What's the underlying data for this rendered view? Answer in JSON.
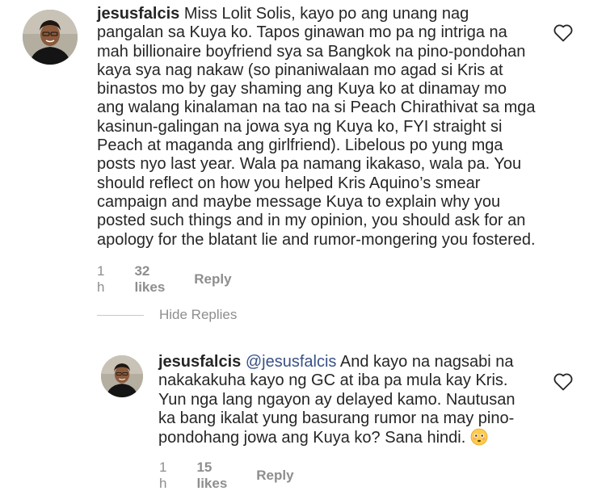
{
  "comments": [
    {
      "username": "jesusfalcis",
      "text": "Miss Lolit Solis, kayo po ang unang nag pangalan sa Kuya ko. Tapos ginawan mo pa ng intriga na mah billionaire boyfriend sya sa Bangkok na pino-pondohan kaya sya nag nakaw (so pinaniwalaan mo agad si Kris at binastos mo by gay shaming ang Kuya ko at dinamay mo ang walang kinalaman na tao na si Peach Chirathivat sa mga kasinun-galingan na jowa sya ng Kuya ko, FYI straight si Peach at maganda ang girlfriend). Libelous po yung mga posts nyo last year. Wala pa namang ikakaso, wala pa. You should reflect on how you helped Kris Aquino’s smear campaign and maybe message Kuya to explain why you posted such things and in my opinion, you should ask for an apology for the blatant lie and rumor-mongering you fostered.",
      "time": "1 h",
      "likes": "32 likes",
      "reply_label": "Reply"
    }
  ],
  "replies_toggle": {
    "label": "Hide Replies"
  },
  "replies": [
    {
      "username": "jesusfalcis",
      "mention": "@jesusfalcis",
      "text": "And kayo na nagsabi na nakakakuha kayo ng GC at iba pa mula kay Kris. Yun nga lang ngayon ay delayed kamo. Nautusan ka bang ikalat yung basurang rumor na may pino-pondohang jowa ang Kuya ko? Sana hindi.",
      "emoji": "flushed-face-emoji",
      "time": "1 h",
      "likes": "15 likes",
      "reply_label": "Reply"
    }
  ],
  "icons": {
    "like": "heart-outline-icon"
  },
  "colors": {
    "text": "#262626",
    "meta": "#8e8e8e",
    "mention": "#385185",
    "divider": "#c7c7c7",
    "emoji": "#ffcc4d"
  }
}
